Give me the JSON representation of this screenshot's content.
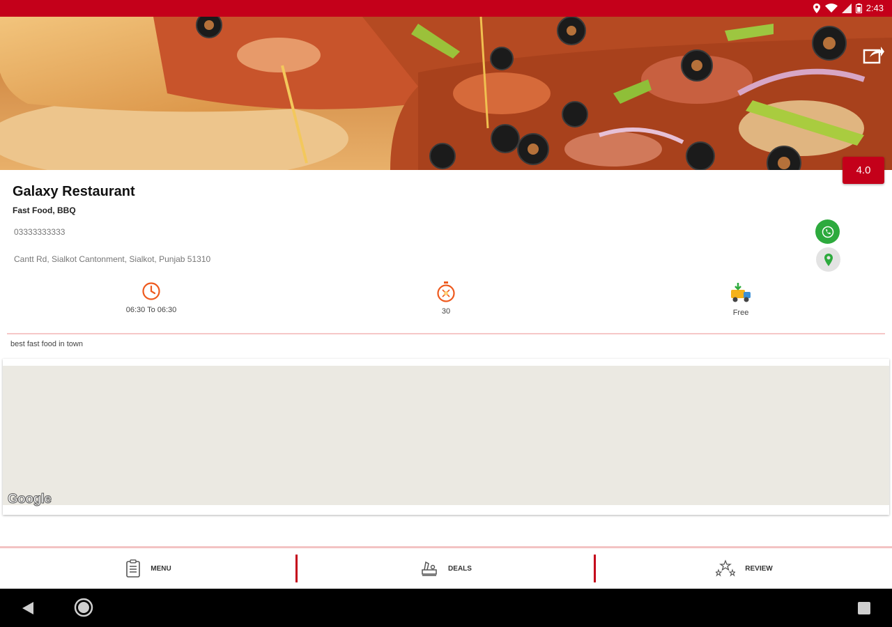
{
  "status_bar": {
    "time": "2:43",
    "bg_color": "#c4001a",
    "icons": [
      "location-icon",
      "wifi-icon",
      "signal-icon",
      "battery-icon"
    ]
  },
  "hero": {
    "image": "pizza-photo",
    "share_icon": "share-icon"
  },
  "restaurant": {
    "rating": "4.0",
    "name": "Galaxy Restaurant",
    "cuisine": "Fast Food, BBQ",
    "phone": "03333333333",
    "address": "Cantt Rd, Sialkot Cantonment, Sialkot, Punjab 51310",
    "description": "best fast food in town"
  },
  "info": {
    "hours": {
      "icon": "clock-icon",
      "text": "06:30 To 06:30"
    },
    "delivery_time": {
      "icon": "stopwatch-icon",
      "text": "30"
    },
    "delivery_fee": {
      "icon": "delivery-truck-icon",
      "text": "Free"
    }
  },
  "map": {
    "logo_text": "Google"
  },
  "tabs": [
    {
      "label": "MENU",
      "icon": "menu-clipboard-icon"
    },
    {
      "label": "DEALS",
      "icon": "deals-chef-icon"
    },
    {
      "label": "REVIEW",
      "icon": "review-stars-icon"
    }
  ],
  "colors": {
    "accent": "#c4001a",
    "call_green": "#2daa3d",
    "icon_orange": "#ee5a1e",
    "divider_pink": "#f6c7c7",
    "map_bg": "#ebe9e2"
  }
}
